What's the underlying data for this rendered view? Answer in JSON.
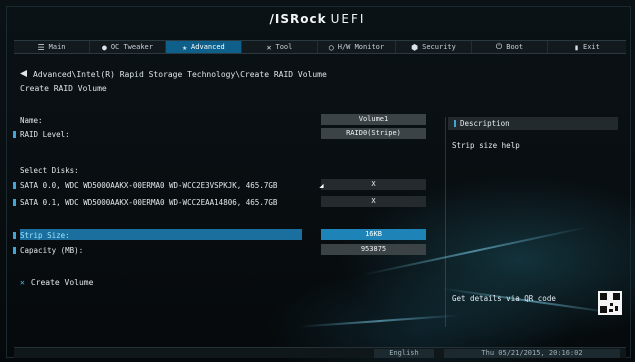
{
  "header": {
    "brand": "/ISRock",
    "product": "UEFI"
  },
  "tabs": [
    {
      "label": "Main",
      "icon": "list-icon",
      "active": false
    },
    {
      "label": "OC Tweaker",
      "icon": "person-icon",
      "active": false
    },
    {
      "label": "Advanced",
      "icon": "star-icon",
      "active": true
    },
    {
      "label": "Tool",
      "icon": "wrench-icon",
      "active": false
    },
    {
      "label": "H/W Monitor",
      "icon": "monitor-icon",
      "active": false
    },
    {
      "label": "Security",
      "icon": "shield-icon",
      "active": false
    },
    {
      "label": "Boot",
      "icon": "power-icon",
      "active": false
    },
    {
      "label": "Exit",
      "icon": "exit-icon",
      "active": false
    }
  ],
  "breadcrumb": "Advanced\\Intel(R) Rapid Storage Technology\\Create RAID Volume",
  "page_title": "Create RAID Volume",
  "fields": {
    "name_label": "Name:",
    "name_value": "Volume1",
    "raid_level_label": "RAID Level:",
    "raid_level_value": "RAID0(Stripe)",
    "select_disks_label": "Select Disks:",
    "disk0_label": "SATA 0.0, WDC WD5000AAKX-00ERMA0 WD-WCC2E3VSPKJK, 465.7GB",
    "disk0_value": "X",
    "disk1_label": "SATA 0.1, WDC WD5000AAKX-00ERMA0 WD-WCC2EAA14806, 465.7GB",
    "disk1_value": "X",
    "strip_size_label": "Strip Size:",
    "strip_size_value": "16KB",
    "capacity_label": "Capacity (MB):",
    "capacity_value": "953875",
    "create_volume_label": "Create Volume"
  },
  "description": {
    "title": "Description",
    "help": "Strip size help",
    "qr_text": "Get details via QR code"
  },
  "status": {
    "language": "English",
    "datetime": "Thu 05/21/2015, 20:16:02"
  },
  "colors": {
    "accent": "#1e84b7",
    "selected_row": "#1a6f9e",
    "value_box": "#3b4347"
  }
}
